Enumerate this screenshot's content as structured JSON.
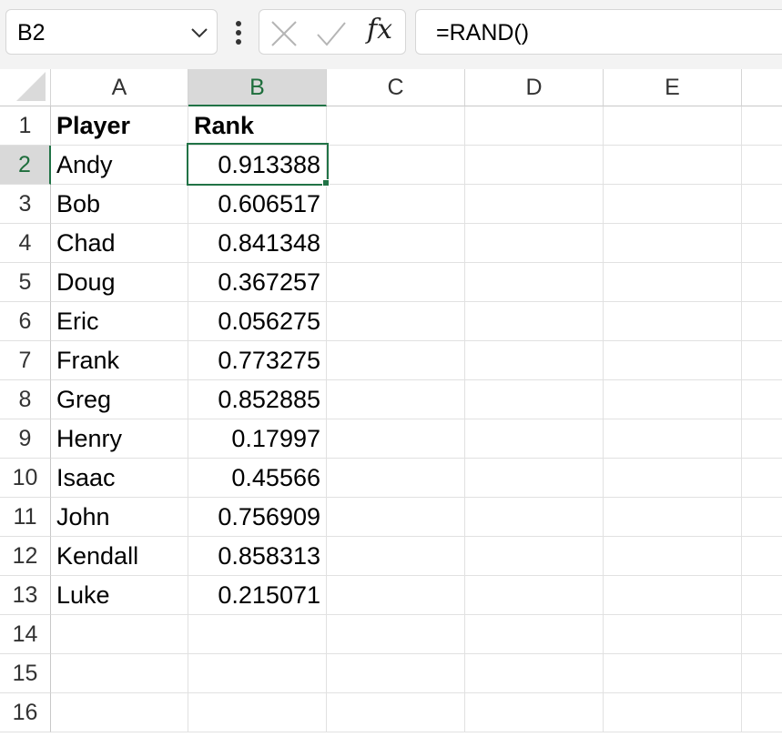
{
  "name_box": {
    "value": "B2",
    "dropdown_icon": "chevron-down-icon"
  },
  "formula_bar": {
    "options_icon": "vertical-ellipsis-icon",
    "cancel_icon": "x-icon",
    "enter_icon": "checkmark-icon",
    "insert_function_label": "fx",
    "formula": "=RAND()"
  },
  "columns": [
    {
      "label": "A",
      "selected": false
    },
    {
      "label": "B",
      "selected": true
    },
    {
      "label": "C",
      "selected": false
    },
    {
      "label": "D",
      "selected": false
    },
    {
      "label": "E",
      "selected": false
    }
  ],
  "rows": [
    {
      "num": "1",
      "A": "Player",
      "B": "Rank"
    },
    {
      "num": "2",
      "A": "Andy",
      "B": "0.913388"
    },
    {
      "num": "3",
      "A": "Bob",
      "B": "0.606517"
    },
    {
      "num": "4",
      "A": "Chad",
      "B": "0.841348"
    },
    {
      "num": "5",
      "A": "Doug",
      "B": "0.367257"
    },
    {
      "num": "6",
      "A": "Eric",
      "B": "0.056275"
    },
    {
      "num": "7",
      "A": "Frank",
      "B": "0.773275"
    },
    {
      "num": "8",
      "A": "Greg",
      "B": "0.852885"
    },
    {
      "num": "9",
      "A": "Henry",
      "B": "0.17997"
    },
    {
      "num": "10",
      "A": "Isaac",
      "B": "0.45566"
    },
    {
      "num": "11",
      "A": "John",
      "B": "0.756909"
    },
    {
      "num": "12",
      "A": "Kendall",
      "B": "0.858313"
    },
    {
      "num": "13",
      "A": "Luke",
      "B": "0.215071"
    },
    {
      "num": "14",
      "A": "",
      "B": ""
    },
    {
      "num": "15",
      "A": "",
      "B": ""
    },
    {
      "num": "16",
      "A": "",
      "B": ""
    }
  ],
  "active_cell": "B2",
  "accent_color": "#217346"
}
